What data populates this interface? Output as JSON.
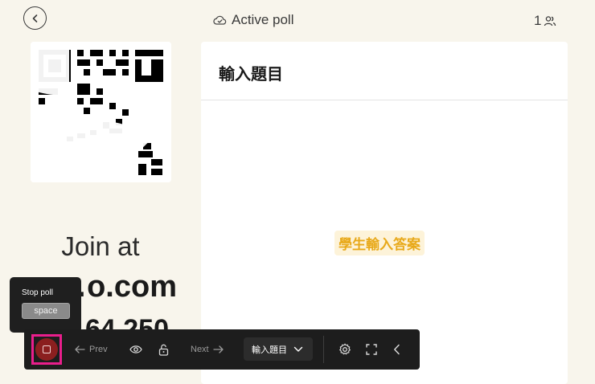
{
  "header": {
    "poll_status": "Active poll",
    "participants_count": "1",
    "icons": {
      "back": "chevron-left-icon",
      "status": "cloud-check-icon",
      "participants": "users-icon"
    }
  },
  "join": {
    "join_label": "Join at",
    "url_partial": "…o.com",
    "code_partial": "64 250"
  },
  "question": {
    "title": "輸入題目",
    "answer_placeholder": "學生輸入答案"
  },
  "tooltip": {
    "label": "Stop poll",
    "shortcut": "space"
  },
  "toolbar": {
    "prev_label": "Prev",
    "next_label": "Next",
    "question_select_value": "輸入題目",
    "icons": [
      "stop-icon",
      "arrow-left-icon",
      "eye-icon",
      "unlock-icon",
      "arrow-right-icon",
      "chevron-down-icon",
      "gear-icon",
      "fullscreen-icon",
      "chevron-left-icon"
    ]
  },
  "colors": {
    "background": "#f8f5ec",
    "toolbar": "#1d1d1d",
    "stop_button": "#8b1f1f",
    "highlight": "#e91e8c",
    "answer_text": "#e8a91a"
  }
}
